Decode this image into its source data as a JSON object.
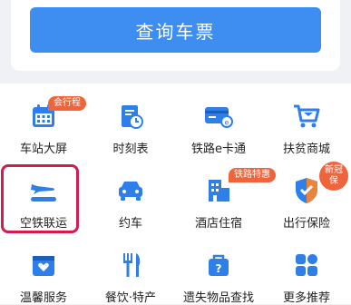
{
  "query_button": {
    "label": "查询车票"
  },
  "grid": {
    "items": [
      {
        "label": "车站大屏",
        "icon": "calendar-icon"
      },
      {
        "label": "时刻表",
        "icon": "timetable-icon"
      },
      {
        "label": "铁路e卡通",
        "icon": "ecard-icon"
      },
      {
        "label": "扶贫商城",
        "icon": "shopping-cart-icon"
      },
      {
        "label": "空铁联运",
        "icon": "airplane-icon"
      },
      {
        "label": "约车",
        "icon": "car-icon"
      },
      {
        "label": "酒店住宿",
        "icon": "hotel-icon"
      },
      {
        "label": "出行保险",
        "icon": "shield-icon"
      },
      {
        "label": "温馨服务",
        "icon": "service-box-icon"
      },
      {
        "label": "餐饮·特产",
        "icon": "dining-icon"
      },
      {
        "label": "遗失物品查找",
        "icon": "lost-items-icon"
      },
      {
        "label": "更多推荐",
        "icon": "more-grid-icon"
      }
    ],
    "badges": {
      "station_screen": "会行程",
      "hotel": "铁路特惠",
      "insurance_line1": "新冠",
      "insurance_line2": "保"
    }
  },
  "colors": {
    "primary": "#3d8ef0",
    "badge": "#f0643c",
    "highlight": "#d01c4f"
  }
}
